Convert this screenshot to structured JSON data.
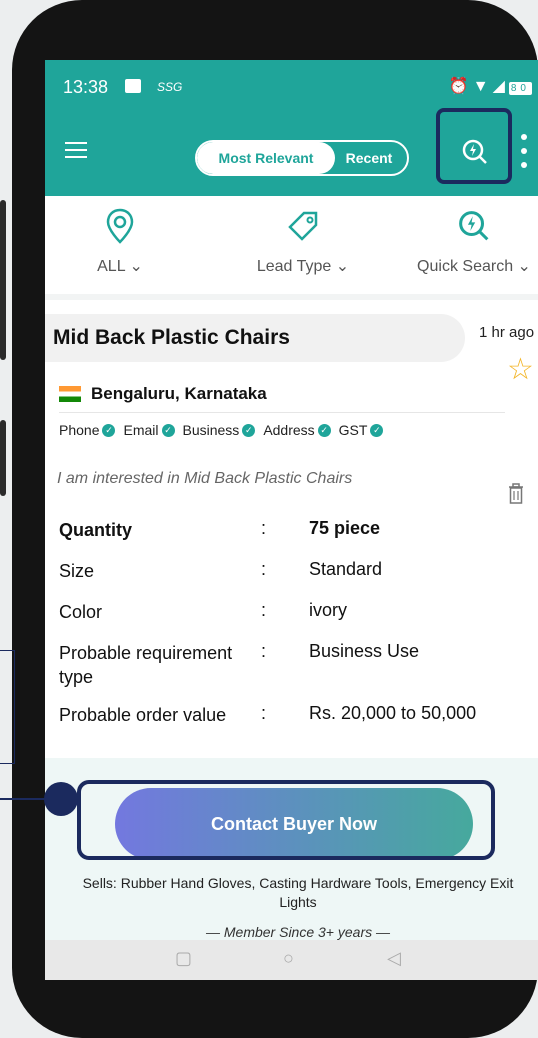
{
  "status_bar": {
    "time": "13:38",
    "carrier_tag": "SSG",
    "right_icons": [
      "alarm-icon",
      "wifi-icon",
      "signal-icon",
      "battery-icon"
    ],
    "battery_level": "80"
  },
  "app_bar": {
    "sort_toggle": {
      "active": "Most Relevant",
      "inactive": "Recent"
    }
  },
  "filters": [
    {
      "label": "ALL",
      "icon": "location-pin-icon"
    },
    {
      "label": "Lead Type",
      "icon": "tag-icon"
    },
    {
      "label": "Quick Search",
      "icon": "quick-search-icon"
    }
  ],
  "lead": {
    "title": "Mid Back Plastic Chairs",
    "time_ago": "1 hr ago",
    "location": "Bengaluru, Karnataka",
    "verifications": [
      "Phone",
      "Email",
      "Business",
      "Address",
      "GST"
    ],
    "message": "I am interested in Mid Back Plastic Chairs",
    "details": [
      {
        "key": "Quantity",
        "sep": ":",
        "value": "75 piece"
      },
      {
        "key": "Size",
        "sep": ":",
        "value": "Standard"
      },
      {
        "key": "Color",
        "sep": ":",
        "value": "ivory"
      },
      {
        "key": "Probable requirement type",
        "sep": ":",
        "value": "Business Use"
      },
      {
        "key": "Probable order value",
        "sep": ":",
        "value": "Rs. 20,000 to 50,000"
      }
    ],
    "cta_label": "Contact Buyer Now",
    "sells": "Sells: Rubber Hand Gloves, Casting Hardware Tools, Emergency Exit Lights",
    "member_since": "— Member Since 3+ years —"
  },
  "colors": {
    "brand_teal": "#1fa59a",
    "highlight_navy": "#1b2a5e",
    "star_gold": "#f3b62a",
    "cta_gradient_start": "#7378df",
    "cta_gradient_end": "#46a99d"
  }
}
